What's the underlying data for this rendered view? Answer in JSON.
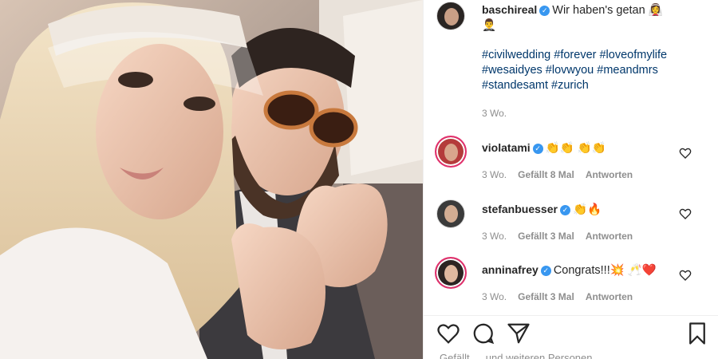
{
  "post": {
    "author": "baschireal",
    "caption": "Wir haben's getan 👰‍♀️",
    "caption_cont": "🤵‍♂️",
    "hashtags": "#civilwedding #forever #loveofmylife #wesaidyes #lovwyou #meandmrs #standesamt #zurich",
    "time": "3 Wo."
  },
  "comments": [
    {
      "user": "violatami",
      "text": "👏👏 👏👏",
      "time": "3 Wo.",
      "likes": "Gefällt 8 Mal",
      "reply": "Antworten"
    },
    {
      "user": "stefanbuesser",
      "text": "👏🔥",
      "time": "3 Wo.",
      "likes": "Gefällt 3 Mal",
      "reply": "Antworten"
    },
    {
      "user": "anninafrey",
      "text": "Congrats!!!💥 🥂❤️",
      "time": "3 Wo.",
      "likes": "Gefällt 3 Mal",
      "reply": "Antworten"
    }
  ],
  "footer": {
    "liked_by": "Gefällt … und weiteren Personen"
  },
  "icons": {
    "verified": "verified-badge-icon",
    "like": "heart-icon",
    "comment": "comment-icon",
    "share": "paper-plane-icon",
    "save": "bookmark-icon"
  },
  "colors": {
    "hashtag": "#00376b",
    "verified": "#3897f0",
    "muted": "#8e8e8e",
    "story_ring": "#e1306c"
  }
}
